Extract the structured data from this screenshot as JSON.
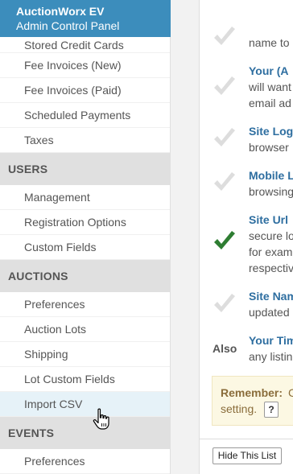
{
  "header": {
    "title": "AuctionWorx EV",
    "subtitle": "Admin Control Panel"
  },
  "sidebar": {
    "top_items": [
      "Stored Credit Cards",
      "Fee Invoices (New)",
      "Fee Invoices (Paid)",
      "Scheduled Payments",
      "Taxes"
    ],
    "users": {
      "title": "USERS",
      "items": [
        "Management",
        "Registration Options",
        "Custom Fields"
      ]
    },
    "auctions": {
      "title": "AUCTIONS",
      "items": [
        "Preferences",
        "Auction Lots",
        "Shipping",
        "Lot Custom Fields",
        "Import CSV"
      ]
    },
    "events": {
      "title": "EVENTS",
      "items": [
        "Preferences"
      ]
    }
  },
  "main": {
    "items": [
      {
        "title": "",
        "lines": [
          "name to"
        ],
        "checked": false
      },
      {
        "title": "Your (A",
        "lines": [
          "will want",
          "email ad"
        ],
        "checked": false
      },
      {
        "title": "Site Logo",
        "lines": [
          "browser"
        ],
        "checked": false
      },
      {
        "title": "Mobile L",
        "lines": [
          "browsing"
        ],
        "checked": false
      },
      {
        "title": "Site Url",
        "lines": [
          "secure lo",
          "for exam",
          "respectiv"
        ],
        "checked": true
      },
      {
        "title": "Site Nam",
        "lines": [
          "updated"
        ],
        "checked": false
      },
      {
        "title": "Your Tim",
        "lines": [
          "any listin"
        ],
        "checked": false
      }
    ],
    "also_label": "Also",
    "remember": {
      "label": "Remember:",
      "text": "C",
      "text2": "setting.",
      "help_button": "?"
    },
    "hide_button": "Hide This List"
  },
  "colors": {
    "header_bg": "#3c8dbc",
    "check_green": "#2e7d32",
    "check_gray": "#dddddd",
    "link_blue": "#2e6ea0"
  }
}
